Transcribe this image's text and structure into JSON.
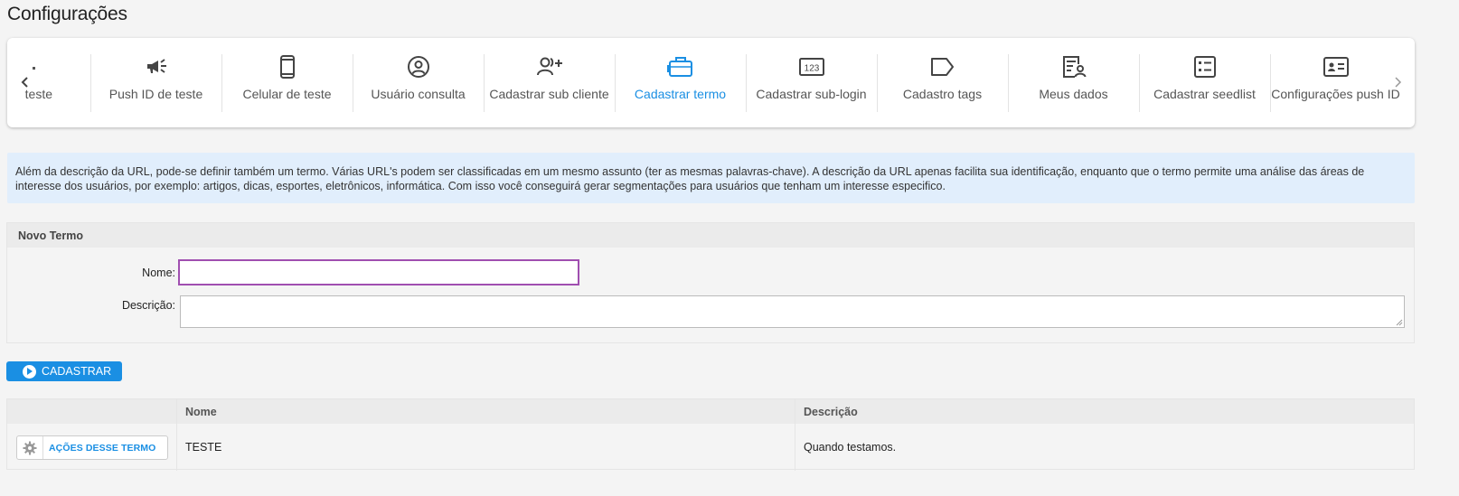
{
  "page_title": "Configurações",
  "carousel": {
    "items": [
      {
        "label": "teste",
        "icon": "partial-icon"
      },
      {
        "label": "Push ID de teste",
        "icon": "megaphone-icon"
      },
      {
        "label": "Celular de teste",
        "icon": "smartphone-icon"
      },
      {
        "label": "Usuário consulta",
        "icon": "user-circle-icon"
      },
      {
        "label": "Cadastrar sub cliente",
        "icon": "add-user-icon"
      },
      {
        "label": "Cadastrar termo",
        "icon": "briefcase-icon",
        "active": true
      },
      {
        "label": "Cadastrar sub-login",
        "icon": "numeric-keypad-icon"
      },
      {
        "label": "Cadastro tags",
        "icon": "tag-icon"
      },
      {
        "label": "Meus dados",
        "icon": "user-document-icon"
      },
      {
        "label": "Cadastrar seedlist",
        "icon": "list-icon"
      },
      {
        "label": "Configurações push ID",
        "icon": "id-card-icon"
      }
    ],
    "active_color": "#1a8fe3"
  },
  "info_text": "Além da descrição da URL, pode-se definir também um termo. Várias URL's podem ser classificadas em um mesmo assunto (ter as mesmas palavras-chave). A descrição da URL apenas facilita sua identificação, enquanto que o termo permite uma análise das áreas de interesse dos usuários, por exemplo: artigos, dicas, esportes, eletrônicos, informática. Com isso você conseguirá gerar segmentações para usuários que tenham um interesse especifico.",
  "form": {
    "header": "Novo Termo",
    "nome_label": "Nome:",
    "nome_value": "",
    "descricao_label": "Descrição:",
    "descricao_value": ""
  },
  "submit_button": "CADASTRAR",
  "table": {
    "columns": [
      "Nome",
      "Descrição"
    ],
    "rows": [
      {
        "action": "AÇÕES DESSE TERMO",
        "nome": "TESTE",
        "descricao": "Quando testamos."
      }
    ]
  }
}
